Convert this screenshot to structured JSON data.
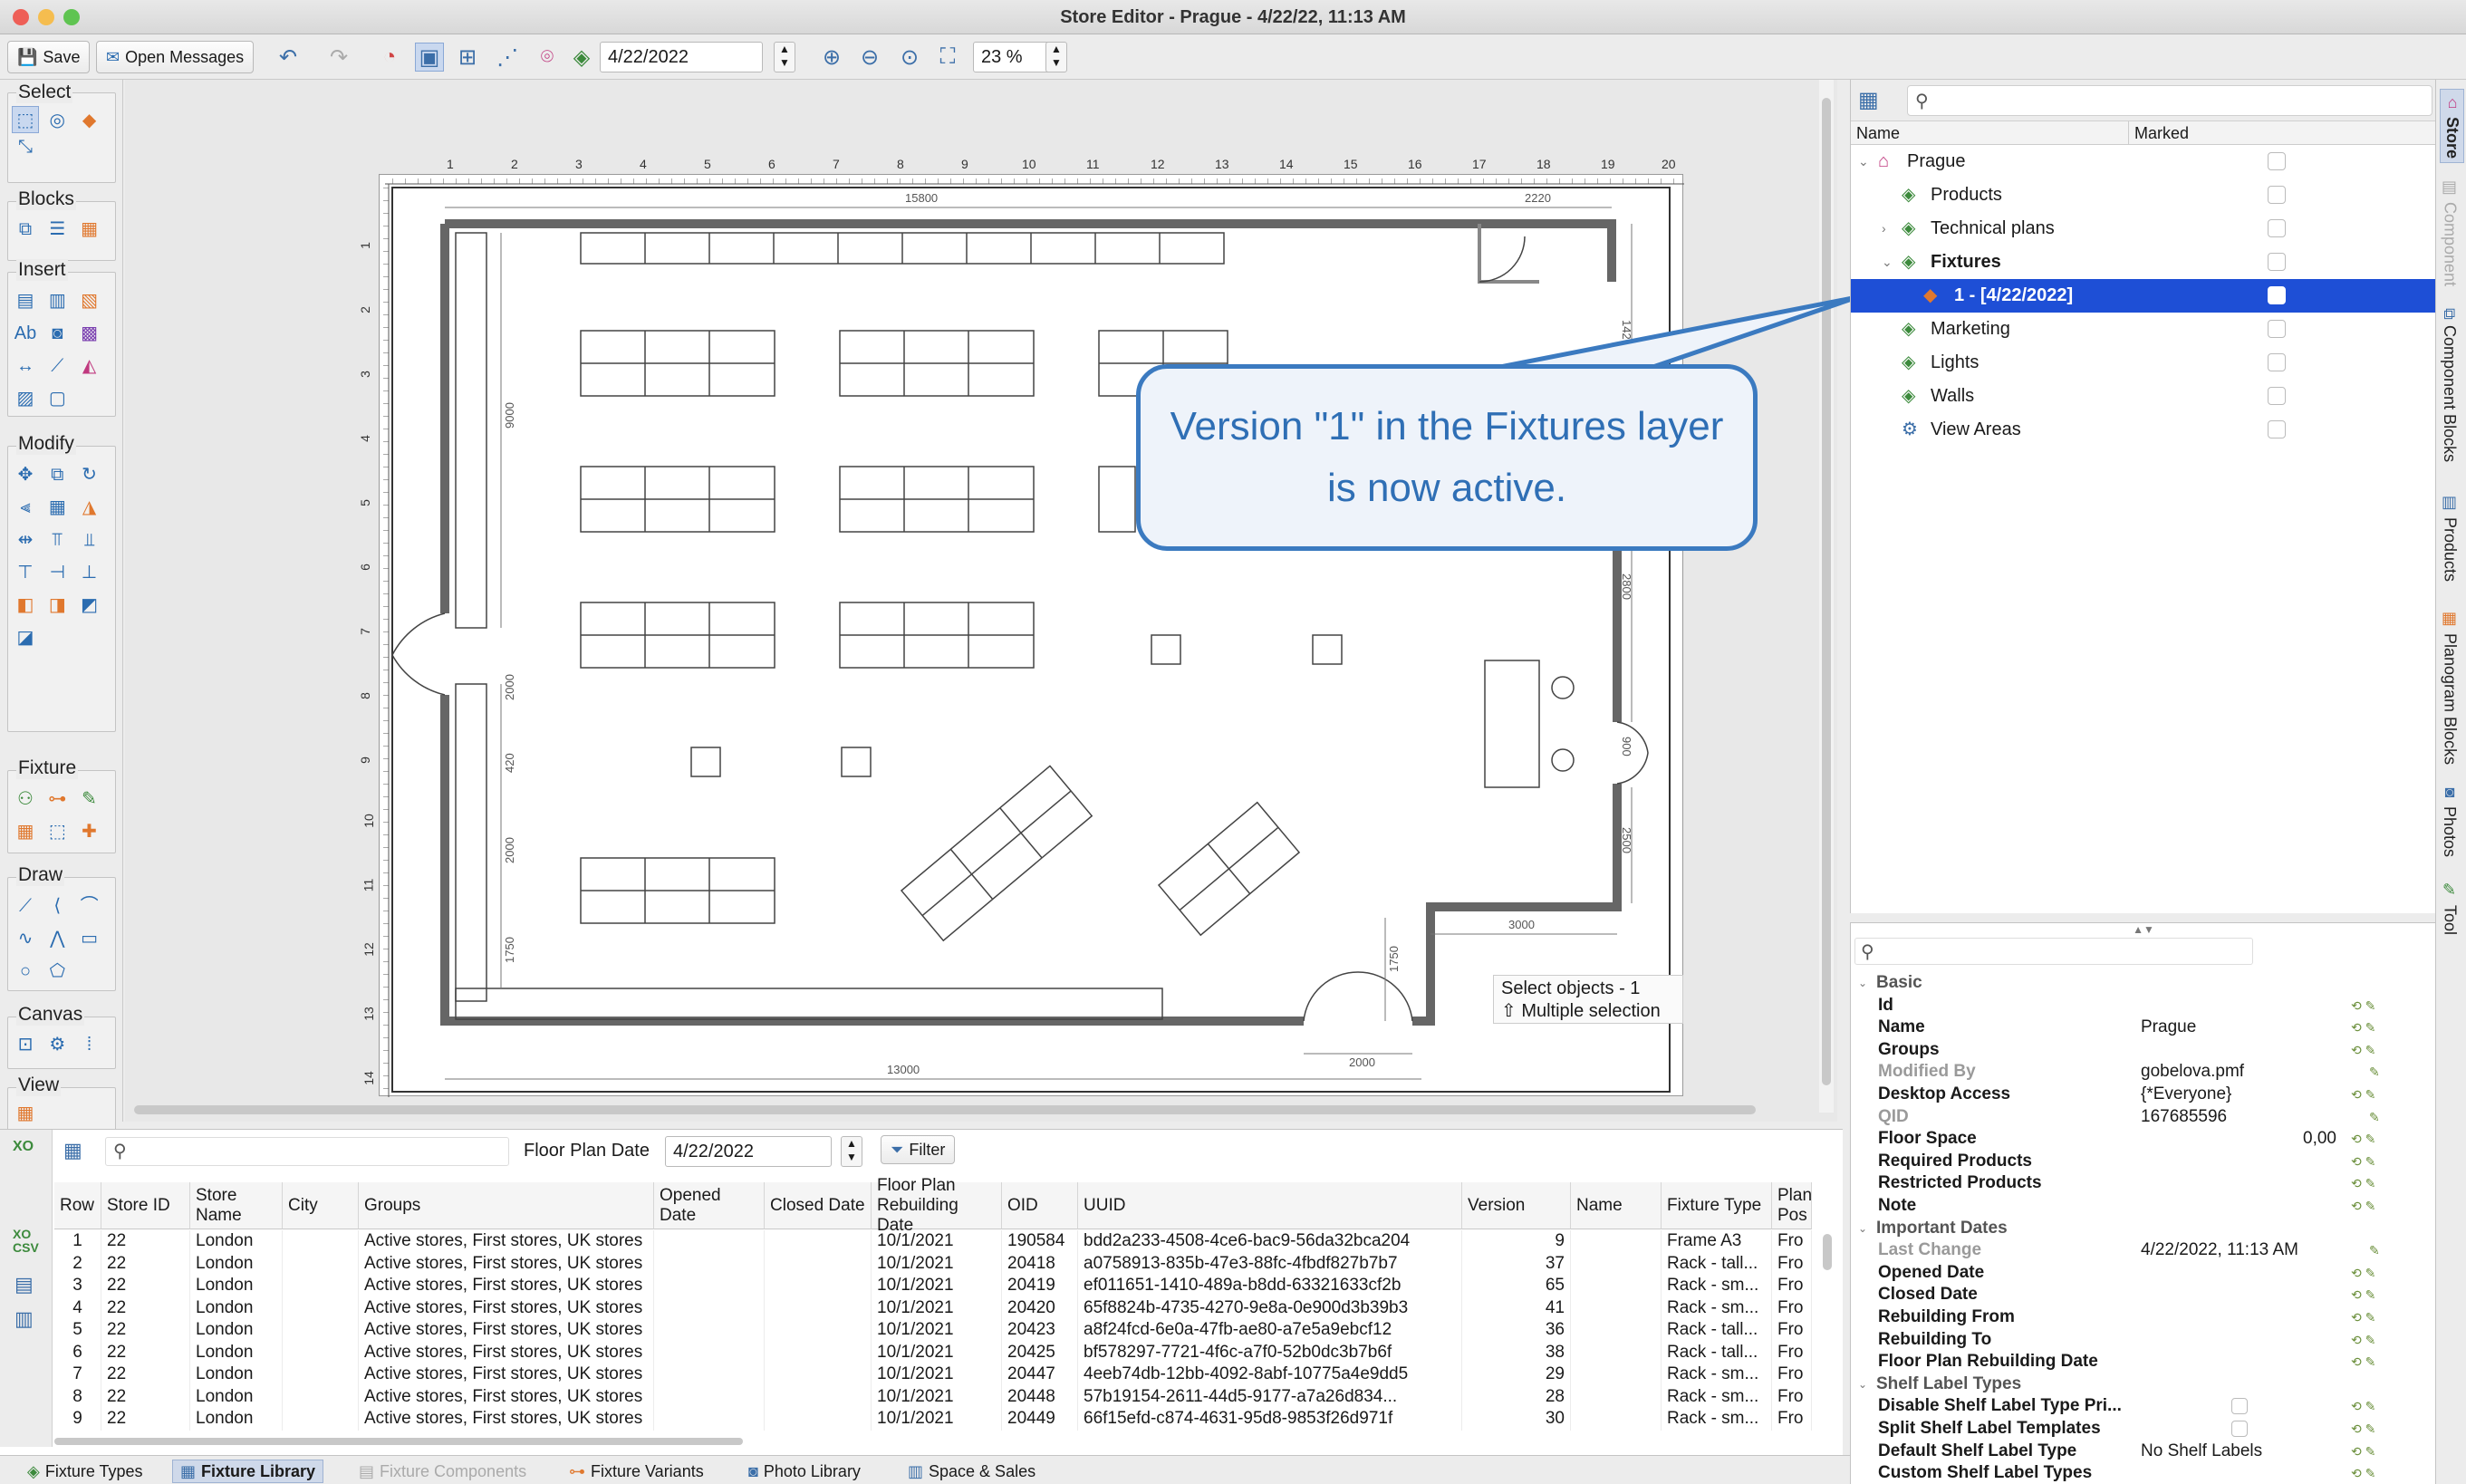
{
  "window": {
    "title": "Store Editor - Prague - 4/22/22, 11:13 AM"
  },
  "toolbar": {
    "save_label": "Save",
    "open_messages_label": "Open Messages",
    "date_value": "4/22/2022",
    "zoom_value": "23 %"
  },
  "palette": {
    "groups": [
      "Select",
      "Blocks",
      "Insert",
      "Modify",
      "Fixture",
      "Draw",
      "Canvas",
      "View"
    ]
  },
  "canvas": {
    "ruler_top": [
      "1",
      "2",
      "3",
      "4",
      "5",
      "6",
      "7",
      "8",
      "9",
      "10",
      "11",
      "12",
      "13",
      "14",
      "15",
      "16",
      "17",
      "18",
      "19",
      "20"
    ],
    "ruler_left": [
      "1",
      "2",
      "3",
      "4",
      "5",
      "6",
      "7",
      "8",
      "9",
      "10",
      "11",
      "12",
      "13",
      "14"
    ],
    "dims": {
      "top": "15800",
      "top_right": "2220",
      "bottom": "13000",
      "bottom_right": "3000",
      "door": "2000",
      "r1": "1420",
      "r2": "2800",
      "r3": "900",
      "r4": "2500",
      "l1": "9000",
      "l2": "2000",
      "l3": "420",
      "l4": "2000",
      "l5": "1750",
      "c1": "1750"
    },
    "status_line1": "Select objects - 1",
    "status_line2": "⇧ Multiple selection"
  },
  "callout": {
    "text": "Version \"1\" in the Fixtures layer is now active."
  },
  "tree": {
    "col_name": "Name",
    "col_marked": "Marked",
    "items": [
      {
        "label": "Prague"
      },
      {
        "label": "Products"
      },
      {
        "label": "Technical plans"
      },
      {
        "label": "Fixtures"
      },
      {
        "label": "1 - [4/22/2022]"
      },
      {
        "label": "Marketing"
      },
      {
        "label": "Lights"
      },
      {
        "label": "Walls"
      },
      {
        "label": "View Areas"
      }
    ]
  },
  "side_tabs": [
    "Store",
    "Component",
    "Component Blocks",
    "Products",
    "Planogram Blocks",
    "Photos",
    "Tool"
  ],
  "properties": {
    "rows": [
      {
        "key": "Basic",
        "value": "",
        "section": true
      },
      {
        "key": "Id",
        "value": ""
      },
      {
        "key": "Name",
        "value": "Prague"
      },
      {
        "key": "Groups",
        "value": ""
      },
      {
        "key": "Modified By",
        "value": "gobelova.pmf",
        "muted": true
      },
      {
        "key": "Desktop Access",
        "value": "{*Everyone}"
      },
      {
        "key": "QID",
        "value": "167685596",
        "muted": true
      },
      {
        "key": "Floor Space",
        "value": "0,00",
        "right": true
      },
      {
        "key": "Required Products",
        "value": ""
      },
      {
        "key": "Restricted Products",
        "value": ""
      },
      {
        "key": "Note",
        "value": ""
      },
      {
        "key": "Important Dates",
        "value": "",
        "section": true
      },
      {
        "key": "Last Change",
        "value": "4/22/2022, 11:13 AM",
        "muted": true
      },
      {
        "key": "Opened Date",
        "value": ""
      },
      {
        "key": "Closed Date",
        "value": ""
      },
      {
        "key": "Rebuilding From",
        "value": ""
      },
      {
        "key": "Rebuilding To",
        "value": ""
      },
      {
        "key": "Floor Plan Rebuilding Date",
        "value": ""
      },
      {
        "key": "Shelf Label Types",
        "value": "",
        "section": true
      },
      {
        "key": "Disable Shelf Label Type Pri...",
        "value": ""
      },
      {
        "key": "Split Shelf Label Templates",
        "value": ""
      },
      {
        "key": "Default Shelf Label Type",
        "value": "No Shelf Labels"
      },
      {
        "key": "Custom Shelf Label Types",
        "value": ""
      }
    ]
  },
  "bottom": {
    "floor_plan_date_label": "Floor Plan Date",
    "floor_plan_date_value": "4/22/2022",
    "filter_label": "Filter",
    "columns": [
      "Row",
      "Store ID",
      "Store Name",
      "City",
      "Groups",
      "Opened Date",
      "Closed Date",
      "Floor Plan Rebuilding Date",
      "OID",
      "UUID",
      "Version",
      "Name",
      "Fixture Type",
      "Plan Pos"
    ],
    "rows": [
      [
        "1",
        "22",
        "London",
        "",
        "Active stores, First stores, UK stores",
        "",
        "",
        "10/1/2021",
        "190584",
        "bdd2a233-4508-4ce6-bac9-56da32bca204",
        "9",
        "",
        "Frame A3",
        "Fro"
      ],
      [
        "2",
        "22",
        "London",
        "",
        "Active stores, First stores, UK stores",
        "",
        "",
        "10/1/2021",
        "20418",
        "a0758913-835b-47e3-88fc-4fbdf827b7b7",
        "37",
        "",
        "Rack - tall...",
        "Fro"
      ],
      [
        "3",
        "22",
        "London",
        "",
        "Active stores, First stores, UK stores",
        "",
        "",
        "10/1/2021",
        "20419",
        "ef011651-1410-489a-b8dd-63321633cf2b",
        "65",
        "",
        "Rack - sm...",
        "Fro"
      ],
      [
        "4",
        "22",
        "London",
        "",
        "Active stores, First stores, UK stores",
        "",
        "",
        "10/1/2021",
        "20420",
        "65f8824b-4735-4270-9e8a-0e900d3b39b3",
        "41",
        "",
        "Rack - sm...",
        "Fro"
      ],
      [
        "5",
        "22",
        "London",
        "",
        "Active stores, First stores, UK stores",
        "",
        "",
        "10/1/2021",
        "20423",
        "a8f24fcd-6e0a-47fb-ae80-a7e5a9ebcf12",
        "36",
        "",
        "Rack - tall...",
        "Fro"
      ],
      [
        "6",
        "22",
        "London",
        "",
        "Active stores, First stores, UK stores",
        "",
        "",
        "10/1/2021",
        "20425",
        "bf578297-7721-4f6c-a7f0-52b0dc3b7b6f",
        "38",
        "",
        "Rack - tall...",
        "Fro"
      ],
      [
        "7",
        "22",
        "London",
        "",
        "Active stores, First stores, UK stores",
        "",
        "",
        "10/1/2021",
        "20447",
        "4eeb74db-12bb-4092-8abf-10775a4e9dd5",
        "29",
        "",
        "Rack - sm...",
        "Fro"
      ],
      [
        "8",
        "22",
        "London",
        "",
        "Active stores, First stores, UK stores",
        "",
        "",
        "10/1/2021",
        "20448",
        "57b19154-2611-44d5-9177-a7a26d834...",
        "28",
        "",
        "Rack - sm...",
        "Fro"
      ],
      [
        "9",
        "22",
        "London",
        "",
        "Active stores, First stores, UK stores",
        "",
        "",
        "10/1/2021",
        "20449",
        "66f15efd-c874-4631-95d8-9853f26d971f",
        "30",
        "",
        "Rack - sm...",
        "Fro"
      ]
    ]
  },
  "tabs": [
    {
      "label": "Fixture Types"
    },
    {
      "label": "Fixture Library",
      "active": true
    },
    {
      "label": "Fixture Components",
      "disabled": true
    },
    {
      "label": "Fixture Variants"
    },
    {
      "label": "Photo Library"
    },
    {
      "label": "Space & Sales"
    }
  ]
}
